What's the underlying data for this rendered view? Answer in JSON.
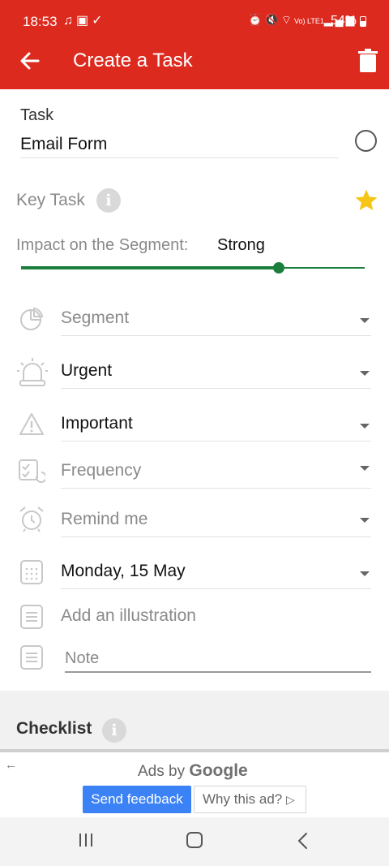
{
  "status_bar": {
    "time": "18:53",
    "left_icons": [
      "music-note-icon",
      "image-icon",
      "check-icon"
    ],
    "right_icons": [
      "alarm-icon",
      "mute-icon",
      "wifi-icon",
      "volte-icon",
      "signal-icon"
    ],
    "volte_text": "Vo) LTE1",
    "battery": "54%"
  },
  "header": {
    "title": "Create a Task",
    "color": "#dd2a1f"
  },
  "task": {
    "label": "Task",
    "value": "Email Form"
  },
  "key_task": {
    "label": "Key Task",
    "starred": true,
    "star_color": "#f5c518"
  },
  "impact": {
    "label": "Impact on the Segment:",
    "value": "Strong",
    "level": 0.75,
    "color": "#1b7f3b"
  },
  "fields": {
    "segment": "Segment",
    "urgent": "Urgent",
    "important": "Important",
    "frequency": "Frequency",
    "remind": "Remind me",
    "date": "Monday, 15 May",
    "illustration": "Add an illustration",
    "note_placeholder": "Note"
  },
  "checklist": {
    "label": "Checklist"
  },
  "ad": {
    "ads_by": "Ads by",
    "brand": "Google",
    "send_feedback": "Send feedback",
    "why_ad": "Why this ad?"
  }
}
